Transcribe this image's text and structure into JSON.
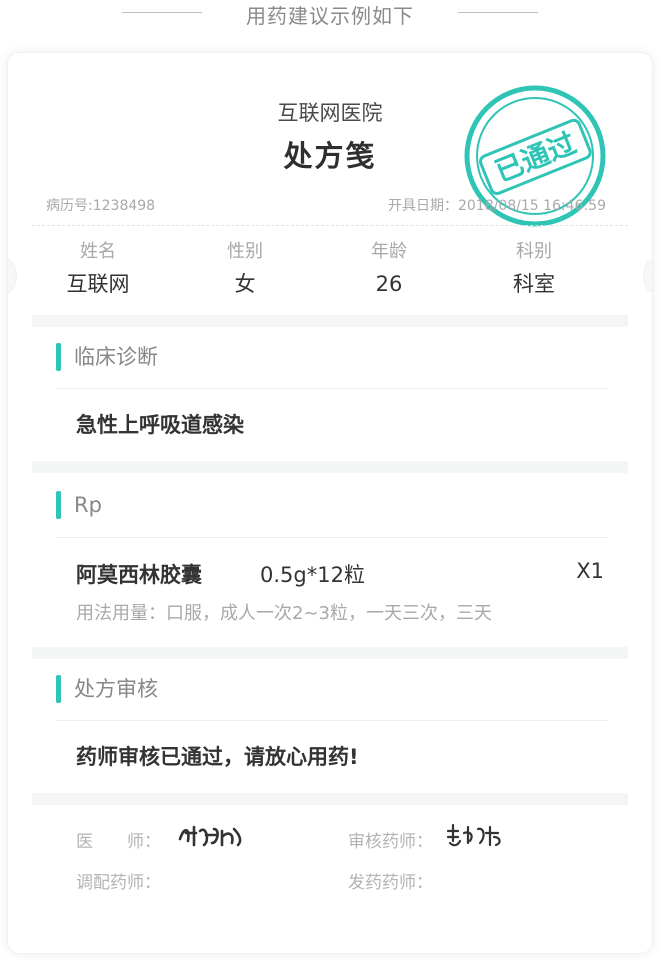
{
  "heading": "用药建议示例如下",
  "prescription": {
    "hospital": "互联网医院",
    "title": "处方笺",
    "stamp_text": "已通过",
    "stamp_color": "#2ec4b6",
    "record_no": "病历号:1238498",
    "issue_date": "开具日期：2018/08/15 16:46:59",
    "patient": {
      "name_label": "姓名",
      "name": "互联网",
      "gender_label": "性别",
      "gender": "女",
      "age_label": "年龄",
      "age": "26",
      "dept_label": "科别",
      "dept": "科室"
    },
    "diagnosis": {
      "title": "临床诊断",
      "text": "急性上呼吸道感染"
    },
    "rp": {
      "title": "Rp",
      "drug_name": "阿莫西林胶囊",
      "drug_spec": "0.5g*12粒",
      "quantity": "X1",
      "usage": "用法用量：口服，成人一次2~3粒，一天三次，三天"
    },
    "review": {
      "title": "处方审核",
      "text": "药师审核已通过，请放心用药!"
    },
    "signatures": {
      "doctor_label": "医　　师：",
      "reviewer_label": "审核药师：",
      "dispenser_label": "调配药师：",
      "issuer_label": "发药药师："
    }
  }
}
